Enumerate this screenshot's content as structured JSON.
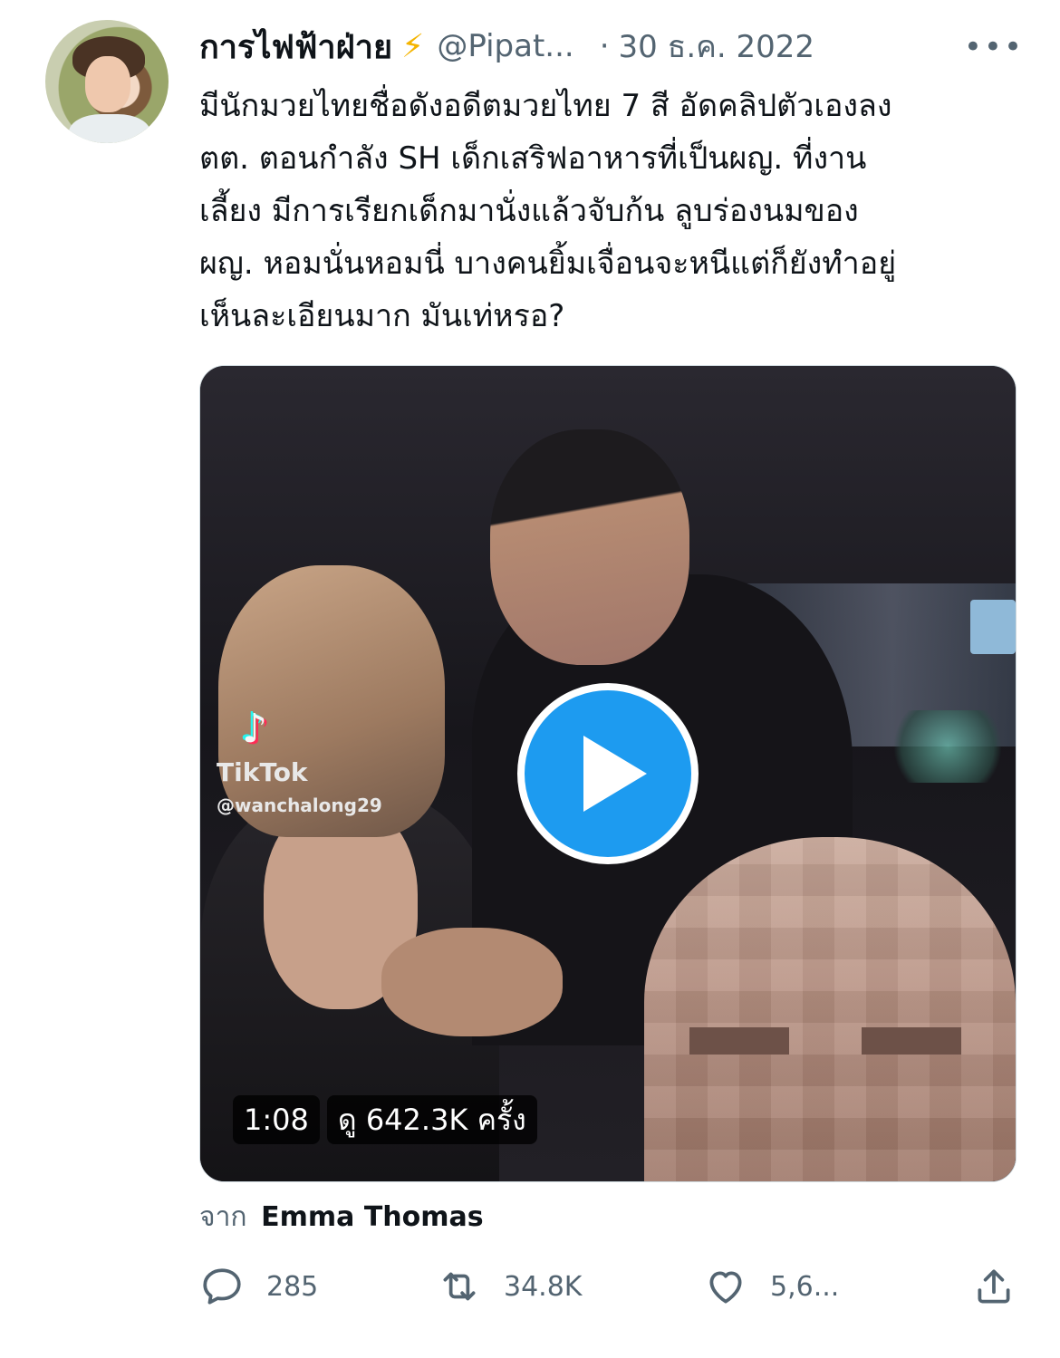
{
  "header": {
    "display_name": "การไฟฟ้าฝ่าย",
    "emoji": "⚡",
    "handle": "@Pipat...",
    "separator": "·",
    "date": "30 ธ.ค. 2022",
    "more": "•••"
  },
  "tweet": {
    "lines": [
      "มีนักมวยไทยชื่อดังอดีตมวยไทย 7 สี อัดคลิปตัวเองลง",
      "ตต. ตอนกำลัง SH เด็กเสริฟอาหารที่เป็นผญ. ที่งาน",
      "เลี้ยง มีการเรียกเด็กมานั่งแล้วจับก้น ลูบร่องนมของ",
      "ผญ. หอมนั่นหอมนี่ บางคนยิ้มเจื่อนจะหนีแต่ก็ยังทำอยู่",
      "เห็นละเอียนมาก มันเท่หรอ?"
    ]
  },
  "media": {
    "watermark_brand": "TikTok",
    "watermark_user": "@wanchalong29",
    "duration": "1:08",
    "views": "ดู 642.3K ครั้ง"
  },
  "attribution": {
    "prefix": "จาก",
    "name": "Emma Thomas"
  },
  "actions": {
    "replies": "285",
    "retweets": "34.8K",
    "likes": "5,6..."
  },
  "colors": {
    "accent": "#1d9bf0",
    "text": "#0f1419",
    "secondary": "#536471"
  }
}
